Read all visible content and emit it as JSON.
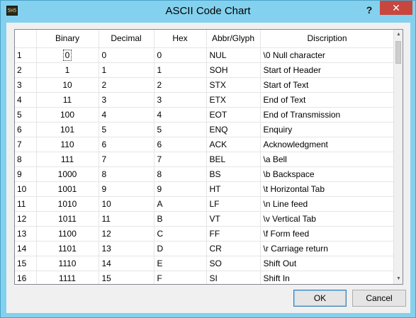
{
  "window": {
    "title": "ASCII Code Chart",
    "app_icon_text": "5H5",
    "help_label": "?",
    "close_label": "✕"
  },
  "table": {
    "columns": [
      "",
      "Binary",
      "Decimal",
      "Hex",
      "Abbr/Glyph",
      "Discription"
    ],
    "rows": [
      [
        "1",
        "0",
        "0",
        "0",
        "NUL",
        "\\0 Null character"
      ],
      [
        "2",
        "1",
        "1",
        "1",
        "SOH",
        "Start of Header"
      ],
      [
        "3",
        "10",
        "2",
        "2",
        "STX",
        "Start of Text"
      ],
      [
        "4",
        "11",
        "3",
        "3",
        "ETX",
        "End of Text"
      ],
      [
        "5",
        "100",
        "4",
        "4",
        "EOT",
        "End of Transmission"
      ],
      [
        "6",
        "101",
        "5",
        "5",
        "ENQ",
        "Enquiry"
      ],
      [
        "7",
        "110",
        "6",
        "6",
        "ACK",
        "Acknowledgment"
      ],
      [
        "8",
        "111",
        "7",
        "7",
        "BEL",
        "\\a Bell"
      ],
      [
        "9",
        "1000",
        "8",
        "8",
        "BS",
        "\\b Backspace"
      ],
      [
        "10",
        "1001",
        "9",
        "9",
        "HT",
        "\\t Horizontal Tab"
      ],
      [
        "11",
        "1010",
        "10",
        "A",
        "LF",
        "\\n Line feed"
      ],
      [
        "12",
        "1011",
        "11",
        "B",
        "VT",
        "\\v Vertical Tab"
      ],
      [
        "13",
        "1100",
        "12",
        "C",
        "FF",
        "\\f Form feed"
      ],
      [
        "14",
        "1101",
        "13",
        "D",
        "CR",
        "\\r Carriage return"
      ],
      [
        "15",
        "1110",
        "14",
        "E",
        "SO",
        "Shift Out"
      ],
      [
        "16",
        "1111",
        "15",
        "F",
        "SI",
        "Shift In"
      ]
    ]
  },
  "buttons": {
    "ok": "OK",
    "cancel": "Cancel"
  }
}
